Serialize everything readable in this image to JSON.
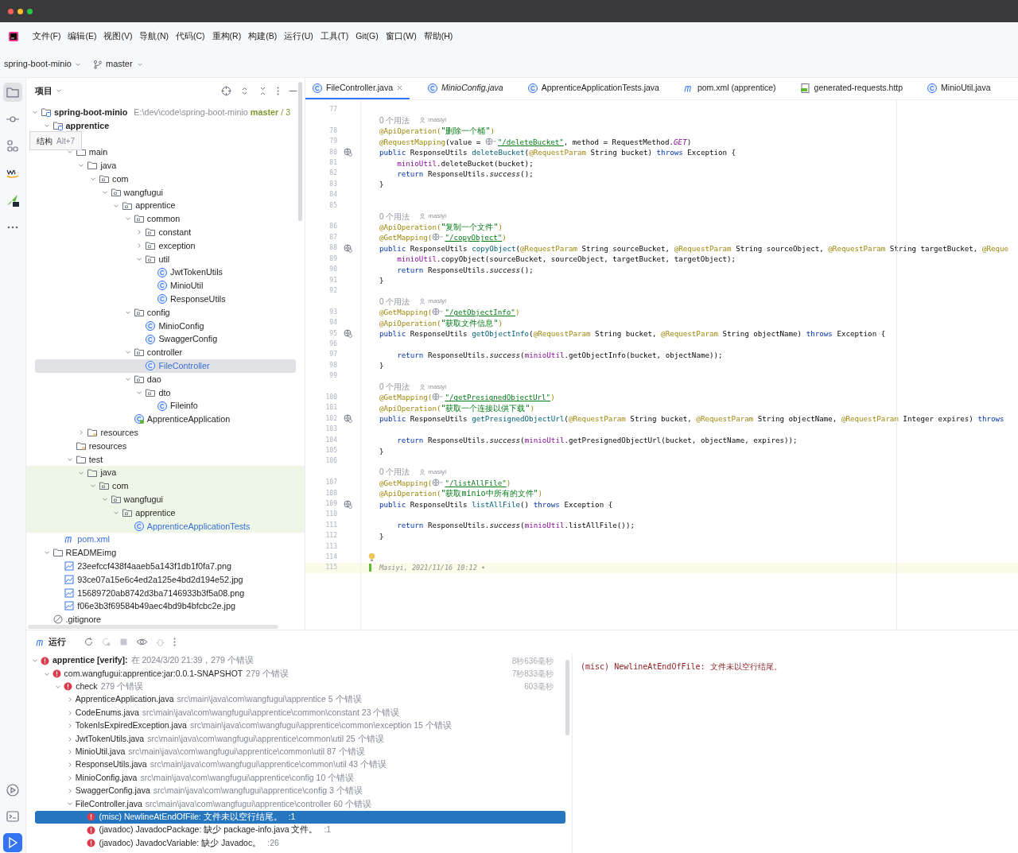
{
  "menu": [
    "文件(F)",
    "编辑(E)",
    "视图(V)",
    "导航(N)",
    "代码(C)",
    "重构(R)",
    "构建(B)",
    "运行(U)",
    "工具(T)",
    "Git(G)",
    "窗口(W)",
    "帮助(H)"
  ],
  "toolbar": {
    "project": "spring-boot-minio",
    "branch": "master"
  },
  "tool_strip": {
    "top": [
      {
        "kind": "project",
        "selected": true
      },
      {
        "kind": "commit",
        "selected": false
      },
      {
        "kind": "structure",
        "selected": false
      },
      {
        "kind": "aws",
        "selected": false
      },
      {
        "kind": "plugin",
        "selected": false
      },
      {
        "kind": "more",
        "selected": false
      }
    ],
    "bottom": [
      {
        "kind": "services",
        "selected": false
      },
      {
        "kind": "terminal",
        "selected": false
      },
      {
        "kind": "run",
        "selected": true
      }
    ]
  },
  "project_panel": {
    "title": "项目",
    "tooltip": {
      "label": "结构",
      "shortcut": "Alt+7"
    },
    "tree": [
      {
        "label": "spring-boot-minio",
        "kind": "module",
        "path": "E:\\dev\\code\\spring-boot-minio",
        "branch": "master",
        "suffix": "/ 3",
        "expanded": true,
        "selected": false,
        "modified": false,
        "test_scope": false,
        "children": [
          {
            "label": "apprentice",
            "kind": "module",
            "expanded": true,
            "selected": false,
            "modified": false,
            "test_scope": false,
            "children": [
              {
                "children": [
                  {
                    "label": "main",
                    "kind": "folder",
                    "expanded": true,
                    "selected": false,
                    "modified": false,
                    "test_scope": false,
                    "children": [
                      {
                        "label": "java",
                        "kind": "source",
                        "expanded": true,
                        "selected": false,
                        "modified": false,
                        "test_scope": false,
                        "children": [
                          {
                            "label": "com",
                            "kind": "package",
                            "expanded": true,
                            "selected": false,
                            "modified": false,
                            "test_scope": false,
                            "children": [
                              {
                                "label": "wangfugui",
                                "kind": "package",
                                "expanded": true,
                                "selected": false,
                                "modified": false,
                                "test_scope": false,
                                "children": [
                                  {
                                    "label": "apprentice",
                                    "kind": "package",
                                    "expanded": true,
                                    "selected": false,
                                    "modified": false,
                                    "test_scope": false,
                                    "children": [
                                      {
                                        "label": "common",
                                        "kind": "package",
                                        "expanded": true,
                                        "selected": false,
                                        "modified": false,
                                        "test_scope": false,
                                        "children": [
                                          {
                                            "label": "constant",
                                            "kind": "package",
                                            "expanded": false,
                                            "selected": false,
                                            "modified": false,
                                            "test_scope": false
                                          },
                                          {
                                            "label": "exception",
                                            "kind": "package",
                                            "expanded": false,
                                            "selected": false,
                                            "modified": false,
                                            "test_scope": false
                                          },
                                          {
                                            "label": "util",
                                            "kind": "package",
                                            "expanded": true,
                                            "selected": false,
                                            "modified": false,
                                            "test_scope": false,
                                            "children": [
                                              {
                                                "label": "JwtTokenUtils",
                                                "kind": "class",
                                                "selected": false,
                                                "modified": false,
                                                "test_scope": false
                                              },
                                              {
                                                "label": "MinioUtil",
                                                "kind": "class",
                                                "selected": false,
                                                "modified": false,
                                                "test_scope": false
                                              },
                                              {
                                                "label": "ResponseUtils",
                                                "kind": "class",
                                                "selected": false,
                                                "modified": false,
                                                "test_scope": false
                                              }
                                            ]
                                          }
                                        ]
                                      },
                                      {
                                        "label": "config",
                                        "kind": "package",
                                        "expanded": true,
                                        "selected": false,
                                        "modified": false,
                                        "test_scope": false,
                                        "children": [
                                          {
                                            "label": "MinioConfig",
                                            "kind": "class",
                                            "selected": false,
                                            "modified": false,
                                            "test_scope": false
                                          },
                                          {
                                            "label": "SwaggerConfig",
                                            "kind": "class",
                                            "selected": false,
                                            "modified": false,
                                            "test_scope": false
                                          }
                                        ]
                                      },
                                      {
                                        "label": "controller",
                                        "kind": "package",
                                        "expanded": true,
                                        "selected": false,
                                        "modified": false,
                                        "test_scope": false,
                                        "children": [
                                          {
                                            "label": "FileController",
                                            "kind": "class",
                                            "selected": true,
                                            "modified": true,
                                            "test_scope": false
                                          }
                                        ]
                                      },
                                      {
                                        "label": "dao",
                                        "kind": "package",
                                        "expanded": true,
                                        "selected": false,
                                        "modified": false,
                                        "test_scope": false,
                                        "children": [
                                          {
                                            "label": "dto",
                                            "kind": "package",
                                            "expanded": true,
                                            "selected": false,
                                            "modified": false,
                                            "test_scope": false,
                                            "children": [
                                              {
                                                "label": "Fileinfo",
                                                "kind": "class",
                                                "selected": false,
                                                "modified": false,
                                                "test_scope": false
                                              }
                                            ]
                                          }
                                        ]
                                      },
                                      {
                                        "label": "ApprenticeApplication",
                                        "kind": "app",
                                        "selected": false,
                                        "modified": false,
                                        "test_scope": false
                                      }
                                    ]
                                  }
                                ]
                              }
                            ]
                          }
                        ]
                      },
                      {
                        "label": "resources",
                        "kind": "resources",
                        "expanded": false,
                        "selected": false,
                        "modified": false,
                        "test_scope": false
                      }
                    ]
                  },
                  {
                    "label": "resources",
                    "kind": "resources",
                    "selected": false,
                    "modified": false,
                    "test_scope": false
                  },
                  {
                    "label": "test",
                    "kind": "folder",
                    "expanded": true,
                    "selected": false,
                    "modified": false,
                    "test_scope": false,
                    "children": [
                      {
                        "label": "java",
                        "kind": "folder",
                        "expanded": true,
                        "selected": false,
                        "modified": false,
                        "test_scope": true,
                        "children": [
                          {
                            "label": "com",
                            "kind": "package",
                            "expanded": true,
                            "selected": false,
                            "modified": false,
                            "test_scope": true,
                            "children": [
                              {
                                "label": "wangfugui",
                                "kind": "package",
                                "expanded": true,
                                "selected": false,
                                "modified": false,
                                "test_scope": true,
                                "children": [
                                  {
                                    "label": "apprentice",
                                    "kind": "package",
                                    "expanded": true,
                                    "selected": false,
                                    "modified": false,
                                    "test_scope": true,
                                    "children": [
                                      {
                                        "label": "ApprenticeApplicationTests",
                                        "kind": "class",
                                        "selected": false,
                                        "modified": true,
                                        "test_scope": true
                                      }
                                    ]
                                  }
                                ]
                              }
                            ]
                          }
                        ]
                      }
                    ]
                  }
                ]
              },
              {
                "label": "pom.xml",
                "kind": "pom",
                "selected": false,
                "modified": true,
                "test_scope": false
              }
            ]
          },
          {
            "label": "READMEimg",
            "kind": "folder",
            "expanded": true,
            "selected": false,
            "modified": false,
            "test_scope": false,
            "children": [
              {
                "label": "23eefccf438f4aaeb5a143f1db1f0fa7.png",
                "kind": "image",
                "selected": false,
                "modified": false,
                "test_scope": false
              },
              {
                "label": "93ce07a15e6c4ed2a125e4bd2d194e52.jpg",
                "kind": "image",
                "selected": false,
                "modified": false,
                "test_scope": false
              },
              {
                "label": "15689720ab8742d3ba7146933b3f5a08.png",
                "kind": "image",
                "selected": false,
                "modified": false,
                "test_scope": false
              },
              {
                "label": "f06e3b3f69584b49aec4bd9b4bfcbc2e.jpg",
                "kind": "image",
                "selected": false,
                "modified": false,
                "test_scope": false
              }
            ]
          },
          {
            "label": ".gitignore",
            "kind": "ignore",
            "selected": false,
            "modified": false,
            "test_scope": false
          }
        ]
      }
    ]
  },
  "editor": {
    "tabs": [
      {
        "label": "FileController.java",
        "kind": "class",
        "selected": true,
        "preview": false,
        "closable": true
      },
      {
        "label": "MinioConfig.java",
        "kind": "class",
        "selected": false,
        "preview": true,
        "closable": false
      },
      {
        "label": "ApprenticeApplicationTests.java",
        "kind": "class",
        "selected": false,
        "preview": false,
        "closable": false
      },
      {
        "label": "pom.xml (apprentice)",
        "kind": "pom",
        "selected": false,
        "preview": false,
        "closable": false
      },
      {
        "label": "generated-requests.http",
        "kind": "http",
        "selected": false,
        "preview": false,
        "closable": false
      },
      {
        "label": "MinioUtil.java",
        "kind": "class",
        "selected": false,
        "preview": false,
        "closable": false
      }
    ],
    "lines": [
      {
        "kind": "code",
        "num": "77"
      },
      {
        "kind": "usage",
        "usages": "0 个用法",
        "author": "masiyi"
      },
      {
        "kind": "code",
        "num": "78",
        "indented": false,
        "segments": [
          {
            "kind": "ann",
            "text": "@ApiOperation("
          },
          {
            "kind": "str",
            "text": "\"删除一个桶\""
          },
          {
            "kind": "ann",
            "text": ")"
          }
        ]
      },
      {
        "kind": "code",
        "num": "79",
        "indented": false,
        "segments": [
          {
            "kind": "ann",
            "text": "@RequestMapping"
          },
          {
            "kind": "plain",
            "text": "(value = "
          },
          {
            "kind": "globe"
          },
          {
            "kind": "url",
            "text": "\"/deleteBucket\""
          },
          {
            "kind": "plain",
            "text": ", method = RequestMethod."
          },
          {
            "kind": "static_field",
            "text": "GET"
          },
          {
            "kind": "plain",
            "text": ")"
          }
        ]
      },
      {
        "kind": "endpoint",
        "num": "80",
        "indented": false,
        "segments": [
          {
            "kind": "kw",
            "text": "public "
          },
          {
            "kind": "plain",
            "text": "ResponseUtils "
          },
          {
            "kind": "fn",
            "text": "deleteBucket"
          },
          {
            "kind": "plain",
            "text": "("
          },
          {
            "kind": "ann",
            "text": "@RequestParam"
          },
          {
            "kind": "plain",
            "text": " String bucket) "
          },
          {
            "kind": "kw",
            "text": "throws"
          },
          {
            "kind": "plain",
            "text": " Exception {"
          }
        ]
      },
      {
        "kind": "code",
        "num": "81",
        "indented": true,
        "segments": [
          {
            "kind": "field",
            "text": "minioUtil"
          },
          {
            "kind": "plain",
            "text": ".deleteBucket(bucket);"
          }
        ]
      },
      {
        "kind": "code",
        "num": "82",
        "indented": true,
        "segments": [
          {
            "kind": "kw",
            "text": "return "
          },
          {
            "kind": "plain",
            "text": "ResponseUtils."
          },
          {
            "kind": "static",
            "text": "success"
          },
          {
            "kind": "plain",
            "text": "();"
          }
        ]
      },
      {
        "kind": "code",
        "num": "83",
        "indented": false,
        "segments": [
          {
            "kind": "plain",
            "text": "}"
          }
        ]
      },
      {
        "kind": "code",
        "num": "84"
      },
      {
        "kind": "code",
        "num": "85"
      },
      {
        "kind": "usage",
        "usages": "0 个用法",
        "author": "masiyi"
      },
      {
        "kind": "code",
        "num": "86",
        "indented": false,
        "segments": [
          {
            "kind": "ann",
            "text": "@ApiOperation("
          },
          {
            "kind": "str",
            "text": "\"复制一个文件\""
          },
          {
            "kind": "ann",
            "text": ")"
          }
        ]
      },
      {
        "kind": "code",
        "num": "87",
        "indented": false,
        "segments": [
          {
            "kind": "ann",
            "text": "@GetMapping("
          },
          {
            "kind": "globe"
          },
          {
            "kind": "url",
            "text": "\"/copyObject\""
          },
          {
            "kind": "ann",
            "text": ")"
          }
        ]
      },
      {
        "kind": "endpoint",
        "num": "88",
        "indented": false,
        "segments": [
          {
            "kind": "kw",
            "text": "public "
          },
          {
            "kind": "plain",
            "text": "ResponseUtils "
          },
          {
            "kind": "fn",
            "text": "copyObject"
          },
          {
            "kind": "plain",
            "text": "("
          },
          {
            "kind": "ann",
            "text": "@RequestParam"
          },
          {
            "kind": "plain",
            "text": " String sourceBucket, "
          },
          {
            "kind": "ann",
            "text": "@RequestParam"
          },
          {
            "kind": "plain",
            "text": " String sourceObject, "
          },
          {
            "kind": "ann",
            "text": "@RequestParam"
          },
          {
            "kind": "plain",
            "text": " String targetBucket, "
          },
          {
            "kind": "ann",
            "text": "@Reque"
          }
        ]
      },
      {
        "kind": "code",
        "num": "89",
        "indented": true,
        "segments": [
          {
            "kind": "field",
            "text": "minioUtil"
          },
          {
            "kind": "plain",
            "text": ".copyObject(sourceBucket, sourceObject, targetBucket, targetObject);"
          }
        ]
      },
      {
        "kind": "code",
        "num": "90",
        "indented": true,
        "segments": [
          {
            "kind": "kw",
            "text": "return "
          },
          {
            "kind": "plain",
            "text": "ResponseUtils."
          },
          {
            "kind": "static",
            "text": "success"
          },
          {
            "kind": "plain",
            "text": "();"
          }
        ]
      },
      {
        "kind": "code",
        "num": "91",
        "indented": false,
        "segments": [
          {
            "kind": "plain",
            "text": "}"
          }
        ]
      },
      {
        "kind": "code",
        "num": "92"
      },
      {
        "kind": "usage",
        "usages": "0 个用法",
        "author": "masiyi"
      },
      {
        "kind": "code",
        "num": "93",
        "indented": false,
        "segments": [
          {
            "kind": "ann",
            "text": "@GetMapping("
          },
          {
            "kind": "globe"
          },
          {
            "kind": "url",
            "text": "\"/getObjectInfo\""
          },
          {
            "kind": "ann",
            "text": ")"
          }
        ]
      },
      {
        "kind": "code",
        "num": "94",
        "indented": false,
        "segments": [
          {
            "kind": "ann",
            "text": "@ApiOperation("
          },
          {
            "kind": "str",
            "text": "\"获取文件信息\""
          },
          {
            "kind": "ann",
            "text": ")"
          }
        ]
      },
      {
        "kind": "endpoint",
        "num": "95",
        "indented": false,
        "segments": [
          {
            "kind": "kw",
            "text": "public "
          },
          {
            "kind": "plain",
            "text": "ResponseUtils "
          },
          {
            "kind": "fn",
            "text": "getObjectInfo"
          },
          {
            "kind": "plain",
            "text": "("
          },
          {
            "kind": "ann",
            "text": "@RequestParam"
          },
          {
            "kind": "plain",
            "text": " String bucket, "
          },
          {
            "kind": "ann",
            "text": "@RequestParam"
          },
          {
            "kind": "plain",
            "text": " String objectName) "
          },
          {
            "kind": "kw",
            "text": "throws"
          },
          {
            "kind": "plain",
            "text": " Exception {"
          }
        ]
      },
      {
        "kind": "code",
        "num": "96"
      },
      {
        "kind": "code",
        "num": "97",
        "indented": true,
        "segments": [
          {
            "kind": "kw",
            "text": "return "
          },
          {
            "kind": "plain",
            "text": "ResponseUtils."
          },
          {
            "kind": "static",
            "text": "success"
          },
          {
            "kind": "plain",
            "text": "("
          },
          {
            "kind": "field",
            "text": "minioUtil"
          },
          {
            "kind": "plain",
            "text": ".getObjectInfo(bucket, objectName));"
          }
        ]
      },
      {
        "kind": "code",
        "num": "98",
        "indented": false,
        "segments": [
          {
            "kind": "plain",
            "text": "}"
          }
        ]
      },
      {
        "kind": "code",
        "num": "99"
      },
      {
        "kind": "usage",
        "usages": "0 个用法",
        "author": "masiyi"
      },
      {
        "kind": "code",
        "num": "100",
        "indented": false,
        "segments": [
          {
            "kind": "ann",
            "text": "@GetMapping("
          },
          {
            "kind": "globe"
          },
          {
            "kind": "url",
            "text": "\"/getPresignedObjectUrl\""
          },
          {
            "kind": "ann",
            "text": ")"
          }
        ]
      },
      {
        "kind": "code",
        "num": "101",
        "indented": false,
        "segments": [
          {
            "kind": "ann",
            "text": "@ApiOperation("
          },
          {
            "kind": "str",
            "text": "\"获取一个连接以供下载\""
          },
          {
            "kind": "ann",
            "text": ")"
          }
        ]
      },
      {
        "kind": "endpoint",
        "num": "102",
        "indented": false,
        "segments": [
          {
            "kind": "kw",
            "text": "public "
          },
          {
            "kind": "plain",
            "text": "ResponseUtils "
          },
          {
            "kind": "fn",
            "text": "getPresignedObjectUrl"
          },
          {
            "kind": "plain",
            "text": "("
          },
          {
            "kind": "ann",
            "text": "@RequestParam"
          },
          {
            "kind": "plain",
            "text": " String bucket, "
          },
          {
            "kind": "ann",
            "text": "@RequestParam"
          },
          {
            "kind": "plain",
            "text": " String objectName, "
          },
          {
            "kind": "ann",
            "text": "@RequestParam"
          },
          {
            "kind": "plain",
            "text": " Integer expires) "
          },
          {
            "kind": "kw",
            "text": "throws"
          }
        ]
      },
      {
        "kind": "code",
        "num": "103"
      },
      {
        "kind": "code",
        "num": "104",
        "indented": true,
        "segments": [
          {
            "kind": "kw",
            "text": "return "
          },
          {
            "kind": "plain",
            "text": "ResponseUtils."
          },
          {
            "kind": "static",
            "text": "success"
          },
          {
            "kind": "plain",
            "text": "("
          },
          {
            "kind": "field",
            "text": "minioUtil"
          },
          {
            "kind": "plain",
            "text": ".getPresignedObjectUrl(bucket, objectName, expires));"
          }
        ]
      },
      {
        "kind": "code",
        "num": "105",
        "indented": false,
        "segments": [
          {
            "kind": "plain",
            "text": "}"
          }
        ]
      },
      {
        "kind": "code",
        "num": "106"
      },
      {
        "kind": "usage",
        "usages": "0 个用法",
        "author": "masiyi"
      },
      {
        "kind": "code",
        "num": "107",
        "indented": false,
        "segments": [
          {
            "kind": "ann",
            "text": "@GetMapping("
          },
          {
            "kind": "globe"
          },
          {
            "kind": "url",
            "text": "\"/listAllFile\""
          },
          {
            "kind": "ann",
            "text": ")"
          }
        ]
      },
      {
        "kind": "code",
        "num": "108",
        "indented": false,
        "segments": [
          {
            "kind": "ann",
            "text": "@ApiOperation("
          },
          {
            "kind": "str",
            "text": "\"获取minio中所有的文件\""
          },
          {
            "kind": "ann",
            "text": ")"
          }
        ]
      },
      {
        "kind": "endpoint",
        "num": "109",
        "indented": false,
        "segments": [
          {
            "kind": "kw",
            "text": "public "
          },
          {
            "kind": "plain",
            "text": "ResponseUtils "
          },
          {
            "kind": "fn",
            "text": "listAllFile"
          },
          {
            "kind": "plain",
            "text": "() "
          },
          {
            "kind": "kw",
            "text": "throws"
          },
          {
            "kind": "plain",
            "text": " Exception {"
          }
        ]
      },
      {
        "kind": "code",
        "num": "110"
      },
      {
        "kind": "code",
        "num": "111",
        "indented": true,
        "segments": [
          {
            "kind": "kw",
            "text": "return "
          },
          {
            "kind": "plain",
            "text": "ResponseUtils."
          },
          {
            "kind": "static",
            "text": "success"
          },
          {
            "kind": "plain",
            "text": "("
          },
          {
            "kind": "field",
            "text": "minioUtil"
          },
          {
            "kind": "plain",
            "text": ".listAllFile());"
          }
        ]
      },
      {
        "kind": "code",
        "num": "112",
        "indented": false,
        "segments": [
          {
            "kind": "plain",
            "text": "}"
          }
        ]
      },
      {
        "kind": "code",
        "num": "113"
      },
      {
        "kind": "bulb",
        "num": "114"
      },
      {
        "kind": "blame",
        "num": "115",
        "text": "Masiyi, 2021/11/16 10:12 •"
      }
    ]
  },
  "run_panel": {
    "title": "运行",
    "output": "(misc) NewlineAtEndOfFile: 文件未以空行结尾。",
    "tree": [
      {
        "kind": "build",
        "name": "apprentice [verify]:",
        "detail": "在 2024/3/20 21:39，279 个错误",
        "time": "8秒636毫秒",
        "expanded": true,
        "selected": false,
        "children": [
          {
            "kind": "module",
            "name": "com.wangfugui:apprentice:jar:0.0.1-SNAPSHOT",
            "detail": "279 个错误",
            "time": "7秒833毫秒",
            "expanded": true,
            "selected": false,
            "children": [
              {
                "kind": "task",
                "name": "check",
                "detail": "279 个错误",
                "time": "603毫秒",
                "expanded": true,
                "selected": false,
                "children": [
                  {
                    "kind": "file",
                    "name": "ApprenticeApplication.java",
                    "detail": "src\\main\\java\\com\\wangfugui\\apprentice 5 个错误",
                    "expanded": false,
                    "selected": false
                  },
                  {
                    "kind": "file",
                    "name": "CodeEnums.java",
                    "detail": "src\\main\\java\\com\\wangfugui\\apprentice\\common\\constant 23 个错误",
                    "expanded": false,
                    "selected": false
                  },
                  {
                    "kind": "file",
                    "name": "TokenIsExpiredException.java",
                    "detail": "src\\main\\java\\com\\wangfugui\\apprentice\\common\\exception 15 个错误",
                    "expanded": false,
                    "selected": false
                  },
                  {
                    "kind": "file",
                    "name": "JwtTokenUtils.java",
                    "detail": "src\\main\\java\\com\\wangfugui\\apprentice\\common\\util 25 个错误",
                    "expanded": false,
                    "selected": false
                  },
                  {
                    "kind": "file",
                    "name": "MinioUtil.java",
                    "detail": "src\\main\\java\\com\\wangfugui\\apprentice\\common\\util 87 个错误",
                    "expanded": false,
                    "selected": false
                  },
                  {
                    "kind": "file",
                    "name": "ResponseUtils.java",
                    "detail": "src\\main\\java\\com\\wangfugui\\apprentice\\common\\util 43 个错误",
                    "expanded": false,
                    "selected": false
                  },
                  {
                    "kind": "file",
                    "name": "MinioConfig.java",
                    "detail": "src\\main\\java\\com\\wangfugui\\apprentice\\config 10 个错误",
                    "expanded": false,
                    "selected": false
                  },
                  {
                    "kind": "file",
                    "name": "SwaggerConfig.java",
                    "detail": "src\\main\\java\\com\\wangfugui\\apprentice\\config 3 个错误",
                    "expanded": false,
                    "selected": false
                  },
                  {
                    "kind": "file",
                    "name": "FileController.java",
                    "detail": "src\\main\\java\\com\\wangfugui\\apprentice\\controller 60 个错误",
                    "expanded": true,
                    "selected": false,
                    "children": [
                      {
                        "kind": "problem",
                        "name": "(misc) NewlineAtEndOfFile: 文件未以空行结尾。",
                        "detail": ":1",
                        "selected": true
                      },
                      {
                        "kind": "problem",
                        "name": "(javadoc) JavadocPackage: 缺少 package-info.java 文件。",
                        "detail": ":1",
                        "selected": false
                      },
                      {
                        "kind": "problem",
                        "name": "(javadoc) JavadocVariable: 缺少 Javadoc。",
                        "detail": ":26",
                        "selected": false
                      }
                    ]
                  }
                ]
              }
            ]
          }
        ]
      }
    ]
  }
}
